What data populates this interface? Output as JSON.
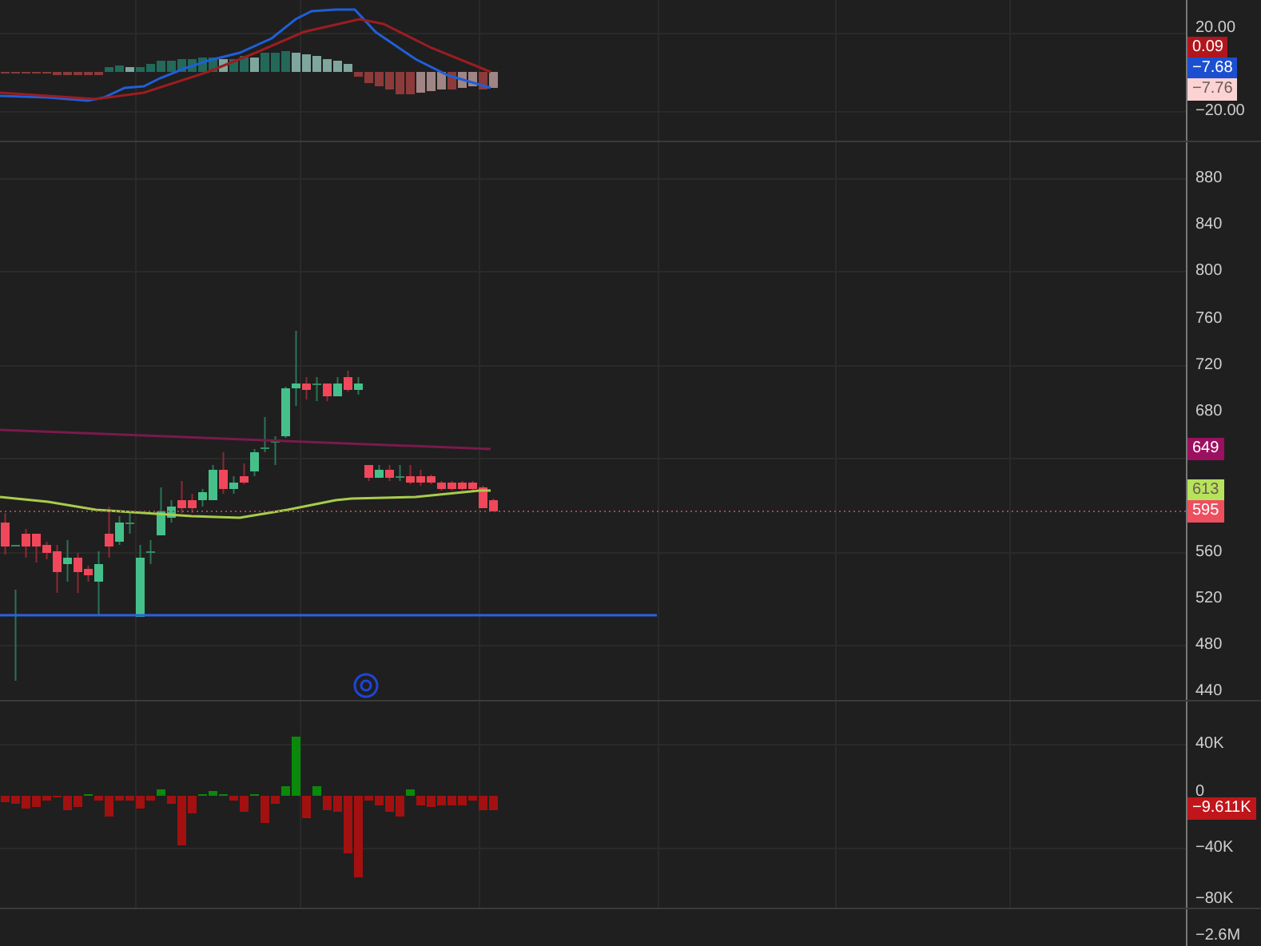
{
  "macd_pane": {
    "axis_labels": [
      "20.00",
      "−20.00"
    ],
    "value_badges": [
      {
        "text": "0.09",
        "color": "#b0161c"
      },
      {
        "text": "−7.68",
        "color": "#1c4fd0"
      },
      {
        "text": "−7.76",
        "color": "#fbd3d3"
      }
    ]
  },
  "price_pane": {
    "axis_labels": [
      "880",
      "840",
      "800",
      "760",
      "720",
      "680",
      "560",
      "520",
      "480",
      "440"
    ],
    "value_badges": [
      {
        "text": "649",
        "color": "#9c1060"
      },
      {
        "text": "613",
        "color": "#b6e35a"
      },
      {
        "text": "595",
        "color": "#ee4f5f"
      }
    ]
  },
  "delta_pane": {
    "axis_labels": [
      "40K",
      "0",
      "−40K",
      "−80K"
    ],
    "value_badges": [
      {
        "text": "−9.611K",
        "color": "#c0151a"
      }
    ]
  },
  "bottom_pane": {
    "axis_labels": [
      "−2.6M"
    ]
  }
}
